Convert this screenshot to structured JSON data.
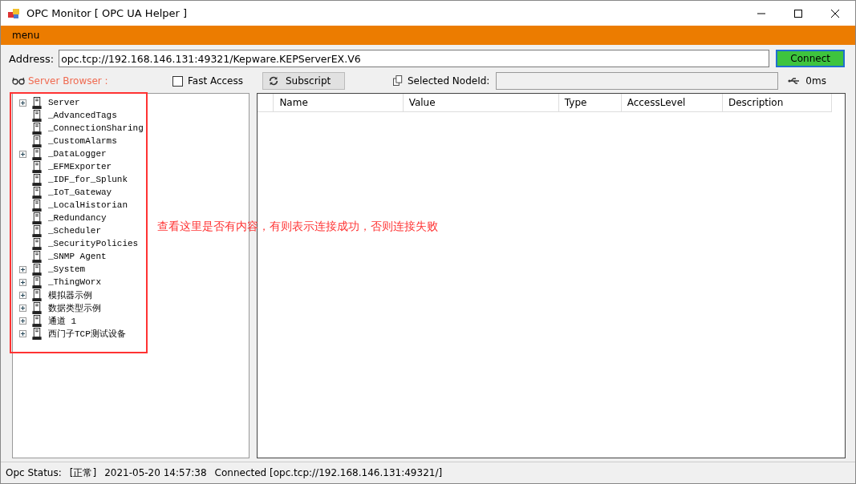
{
  "window": {
    "title": "OPC Monitor [ OPC UA Helper ]"
  },
  "menu": {
    "label": "menu"
  },
  "address": {
    "label": "Address:",
    "value": "opc.tcp://192.168.146.131:49321/Kepware.KEPServerEX.V6"
  },
  "connect_button": {
    "label": "Connect"
  },
  "server_browser": {
    "label": "Server Browser :"
  },
  "fast_access": {
    "label": "Fast Access",
    "checked": false
  },
  "subscript_button": {
    "label": "Subscript"
  },
  "selected_node": {
    "label": "Selected NodeId:"
  },
  "latency": "0ms",
  "tree": [
    {
      "label": "Server",
      "expandable": true
    },
    {
      "label": "_AdvancedTags",
      "expandable": false
    },
    {
      "label": "_ConnectionSharing",
      "expandable": false
    },
    {
      "label": "_CustomAlarms",
      "expandable": false
    },
    {
      "label": "_DataLogger",
      "expandable": true
    },
    {
      "label": "_EFMExporter",
      "expandable": false
    },
    {
      "label": "_IDF_for_Splunk",
      "expandable": false
    },
    {
      "label": "_IoT_Gateway",
      "expandable": false
    },
    {
      "label": "_LocalHistorian",
      "expandable": false
    },
    {
      "label": "_Redundancy",
      "expandable": false
    },
    {
      "label": "_Scheduler",
      "expandable": false
    },
    {
      "label": "_SecurityPolicies",
      "expandable": false
    },
    {
      "label": "_SNMP Agent",
      "expandable": false
    },
    {
      "label": "_System",
      "expandable": true
    },
    {
      "label": "_ThingWorx",
      "expandable": true
    },
    {
      "label": "模拟器示例",
      "expandable": true
    },
    {
      "label": "数据类型示例",
      "expandable": true
    },
    {
      "label": "通道 1",
      "expandable": true
    },
    {
      "label": "西门子TCP测试设备",
      "expandable": true
    }
  ],
  "table": {
    "columns": [
      "Name",
      "Value",
      "Type",
      "AccessLevel",
      "Description"
    ]
  },
  "annotation": "查看这里是否有内容，有则表示连接成功，否则连接失败",
  "status_bar": {
    "label": "Opc Status:",
    "state": "[正常]",
    "time": "2021-05-20 14:57:38",
    "message": "Connected [opc.tcp://192.168.146.131:49321/]"
  }
}
